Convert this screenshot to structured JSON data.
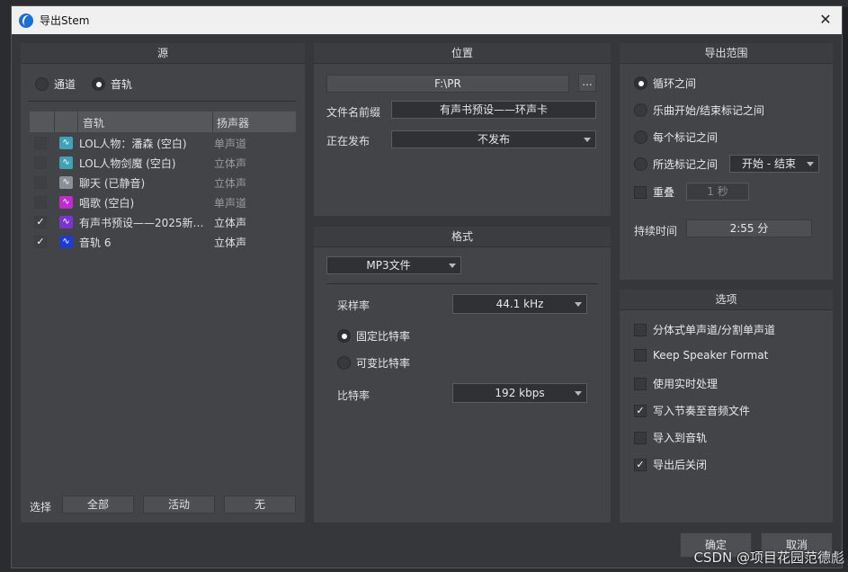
{
  "window": {
    "title": "导出Stem",
    "close_glyph": "✕"
  },
  "source": {
    "header": "源",
    "mode_channel": "通道",
    "mode_track": "音轨",
    "selected_mode": "音轨",
    "col_track": "音轨",
    "col_speaker": "扬声器",
    "tracks": [
      {
        "name": "LOL人物：潘森 (空白)",
        "speaker": "单声道",
        "checked": false,
        "color": "#3fa3b8",
        "dim": true
      },
      {
        "name": "LOL人物剑魔 (空白)",
        "speaker": "立体声",
        "checked": false,
        "color": "#3fa3b8",
        "dim": true
      },
      {
        "name": "聊天 (已静音)",
        "speaker": "立体声",
        "checked": false,
        "color": "#8a9098",
        "dim": true
      },
      {
        "name": "唱歌 (空白)",
        "speaker": "单声道",
        "checked": false,
        "color": "#c02ad0",
        "dim": true
      },
      {
        "name": "有声书预设——2025新年...",
        "speaker": "立体声",
        "checked": true,
        "color": "#7a35d0",
        "dim": false
      },
      {
        "name": "音轨 6",
        "speaker": "立体声",
        "checked": true,
        "color": "#1f3ad0",
        "dim": false
      }
    ],
    "select_label": "选择",
    "btn_all": "全部",
    "btn_active": "活动",
    "btn_none": "无"
  },
  "location": {
    "header": "位置",
    "path": "F:\\PR",
    "browse": "...",
    "prefix_label": "文件名前缀",
    "prefix_value": "有声书预设——环声卡",
    "publish_label": "正在发布",
    "publish_value": "不发布"
  },
  "format": {
    "header": "格式",
    "type": "MP3文件",
    "samplerate_label": "采样率",
    "samplerate_value": "44.1 kHz",
    "cbr": "固定比特率",
    "vbr": "可变比特率",
    "bitrate_mode": "固定比特率",
    "bitrate_label": "比特率",
    "bitrate_value": "192 kbps"
  },
  "range": {
    "header": "导出范围",
    "loop": "循环之间",
    "song": "乐曲开始/结束标记之间",
    "each_marker": "每个标记之间",
    "selected_markers": "所选标记之间",
    "selected": "循环之间",
    "marker_combo": "开始 - 结束",
    "overlap_label": "重叠",
    "overlap_value": "1 秒",
    "overlap_checked": false,
    "duration_label": "持续时间",
    "duration_value": "2:55 分"
  },
  "options": {
    "header": "选项",
    "items": [
      {
        "label": "分体式单声道/分割单声道",
        "checked": false
      },
      {
        "label": "Keep Speaker Format",
        "checked": false
      },
      {
        "label": "使用实时处理",
        "checked": false
      },
      {
        "label": "写入节奏至音频文件",
        "checked": true
      },
      {
        "label": "导入到音轨",
        "checked": false
      },
      {
        "label": "导出后关闭",
        "checked": true
      }
    ]
  },
  "footer": {
    "ok": "确定",
    "cancel": "取消"
  },
  "watermark": "CSDN @项目花园范德彪"
}
